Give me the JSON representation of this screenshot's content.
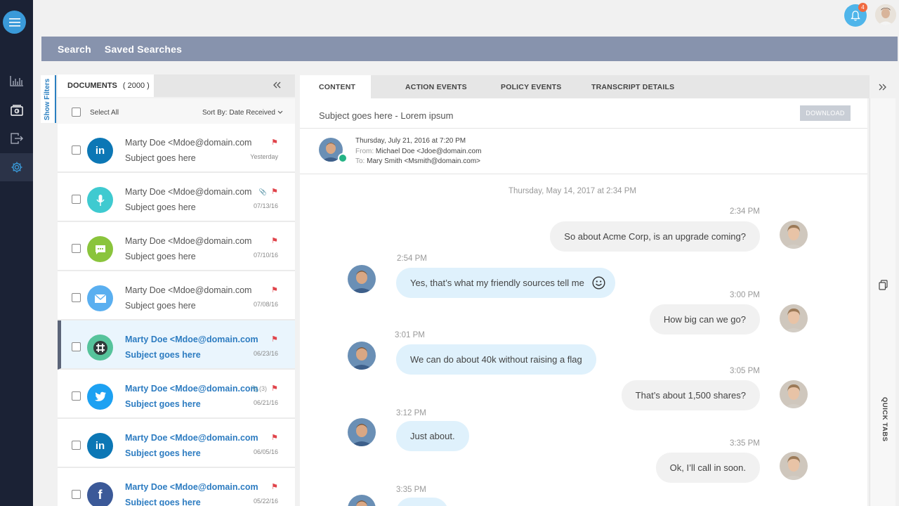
{
  "topbar": {
    "notification_count": "4"
  },
  "search_tabs": [
    {
      "label": "Search"
    },
    {
      "label": "Saved Searches"
    }
  ],
  "filters": {
    "label": "Show Filters"
  },
  "documents": {
    "header": "DOCUMENTS",
    "count": "( 2000 )",
    "select_all": "Select All",
    "sort": "Sort By: Date Received",
    "items": [
      {
        "source": "linkedin",
        "from": "Marty Doe <Mdoe@domain.com",
        "subject": "Subject goes here",
        "date": "Yesterday",
        "attachments": "",
        "unread": false,
        "selected": false
      },
      {
        "source": "voice",
        "from": "Marty Doe <Mdoe@domain.com",
        "subject": "Subject goes here",
        "date": "07/13/16",
        "attachments": "📎",
        "unread": false,
        "selected": false
      },
      {
        "source": "chat",
        "from": "Marty Doe <Mdoe@domain.com",
        "subject": "Subject goes here",
        "date": "07/10/16",
        "attachments": "",
        "unread": false,
        "selected": false
      },
      {
        "source": "email",
        "from": "Marty Doe <Mdoe@domain.com",
        "subject": "Subject goes here",
        "date": "07/08/16",
        "attachments": "",
        "unread": false,
        "selected": false
      },
      {
        "source": "slack",
        "from": "Marty Doe <Mdoe@domain.com",
        "subject": "Subject goes here",
        "date": "06/23/16",
        "attachments": "",
        "unread": true,
        "selected": true
      },
      {
        "source": "twitter",
        "from": "Marty Doe <Mdoe@domain.com",
        "subject": "Subject goes here",
        "date": "06/21/16",
        "attachments": "📎(3)",
        "unread": true,
        "selected": false
      },
      {
        "source": "linkedin",
        "from": "Marty Doe <Mdoe@domain.com",
        "subject": "Subject goes here",
        "date": "06/05/16",
        "attachments": "",
        "unread": true,
        "selected": false
      },
      {
        "source": "facebook",
        "from": "Marty Doe <Mdoe@domain.com",
        "subject": "Subject goes here",
        "date": "05/22/16",
        "attachments": "",
        "unread": true,
        "selected": false
      }
    ]
  },
  "content_tabs": [
    {
      "label": "CONTENT"
    },
    {
      "label": "ACTION EVENTS"
    },
    {
      "label": "POLICY EVENTS"
    },
    {
      "label": "TRANSCRIPT DETAILS"
    }
  ],
  "message": {
    "subject": "Subject goes here - Lorem ipsum",
    "download": "DOWNLOAD",
    "datetime": "Thursday, July 21, 2016 at 7:20 PM",
    "from_label": "From:",
    "from": "Michael Doe <Jdoe@domain.com",
    "to_label": "To:",
    "to": "Mary Smith <Msmith@domain.com>"
  },
  "transcript": {
    "day": "Thursday, May 14, 2017 at 2:34 PM",
    "messages": [
      {
        "dir": "out",
        "time": "2:34 PM",
        "text": "So about Acme Corp, is an upgrade coming?"
      },
      {
        "dir": "in",
        "time": "2:54 PM",
        "text": "Yes, that’s what my friendly sources tell me"
      },
      {
        "dir": "out",
        "time": "3:00 PM",
        "text": "How big can we go?"
      },
      {
        "dir": "in",
        "time": "3:01 PM",
        "text": "We can do about 40k without raising a flag"
      },
      {
        "dir": "out",
        "time": "3:05 PM",
        "text": "That’s about 1,500 shares?"
      },
      {
        "dir": "in",
        "time": "3:12 PM",
        "text": "Just about."
      },
      {
        "dir": "out",
        "time": "3:35 PM",
        "text": "Ok, I’ll call in soon."
      },
      {
        "dir": "in",
        "time": "3:35 PM",
        "text": ""
      }
    ]
  },
  "quick_tabs": {
    "label": "QUICK TABS"
  },
  "colors": {
    "rail": "#1b2235",
    "accent": "#3a9ad9",
    "search_bar": "#8793ad",
    "unread_text": "#2d7cc1",
    "bubble_in": "#dff1fc",
    "bubble_out": "#f1f1f1"
  }
}
